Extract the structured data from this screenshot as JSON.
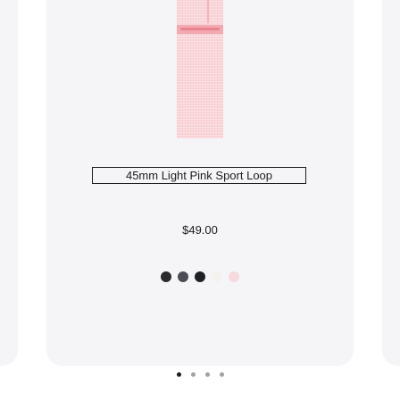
{
  "product": {
    "name": "45mm Light Pink Sport Loop",
    "price": "$49.00"
  },
  "swatches": [
    {
      "name": "swatch-1",
      "color": "#2a2a2c"
    },
    {
      "name": "swatch-2",
      "color": "#4a4d55"
    },
    {
      "name": "swatch-3",
      "color": "#1f2024"
    },
    {
      "name": "swatch-4",
      "color": "#f4f1ee"
    },
    {
      "name": "swatch-5",
      "color": "#f6dadd"
    }
  ],
  "pagination": {
    "count": 4,
    "active_index": 0
  }
}
